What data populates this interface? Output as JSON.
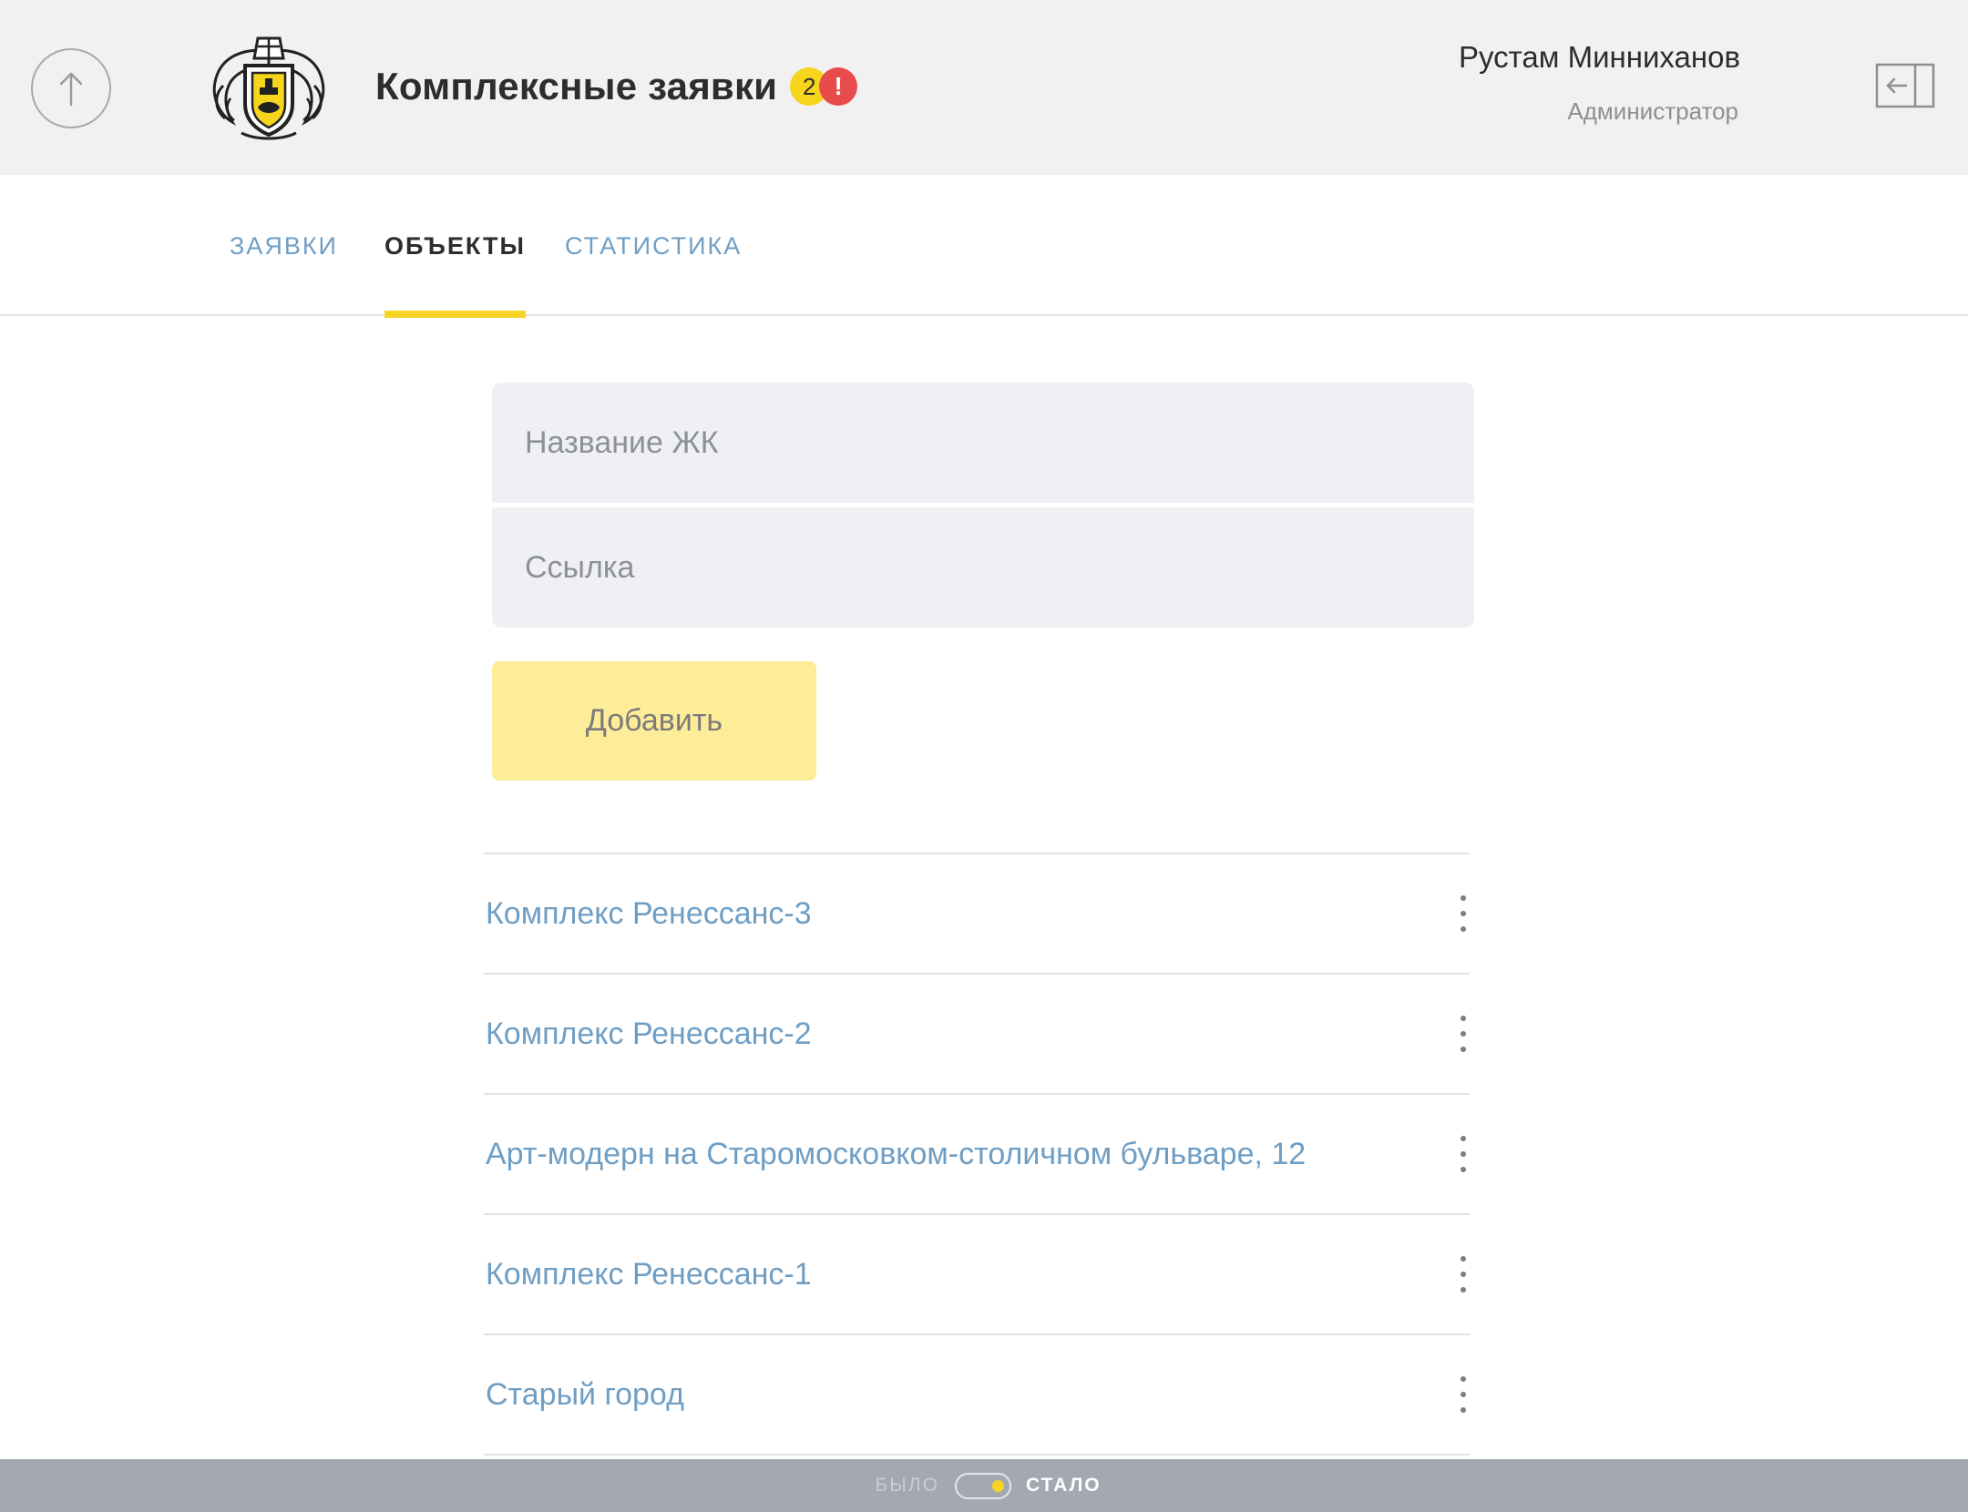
{
  "header": {
    "title": "Комплексные заявки",
    "badge_count": "2",
    "badge_alert": "!",
    "user_name": "Рустам Минниханов",
    "user_role": "Администратор",
    "icons": {
      "back": "arrow-up-icon",
      "logo": "coat-of-arms-logo",
      "logout": "logout-icon"
    }
  },
  "tabs": [
    {
      "label": "ЗАЯВКИ",
      "active": false
    },
    {
      "label": "ОБЪЕКТЫ",
      "active": true
    },
    {
      "label": "СТАТИСТИКА",
      "active": false
    }
  ],
  "form": {
    "name_placeholder": "Название ЖК",
    "name_value": "",
    "link_placeholder": "Ссылка",
    "link_value": "",
    "add_label": "Добавить"
  },
  "objects": [
    {
      "name": "Комплекс Ренессанс-3"
    },
    {
      "name": "Комплекс Ренессанс-2"
    },
    {
      "name": "Арт-модерн на Старомосковком-столичном бульваре, 12"
    },
    {
      "name": "Комплекс Ренессанс-1"
    },
    {
      "name": "Старый город"
    }
  ],
  "bottom_bar": {
    "before_label": "БЫЛО",
    "after_label": "СТАЛО",
    "toggle_state": "after"
  },
  "colors": {
    "accent_yellow": "#f7d525",
    "link_blue": "#6f9ec4",
    "alert_red": "#e84b4b",
    "header_bg": "#f1f1f2",
    "field_bg": "#eef0f4"
  }
}
